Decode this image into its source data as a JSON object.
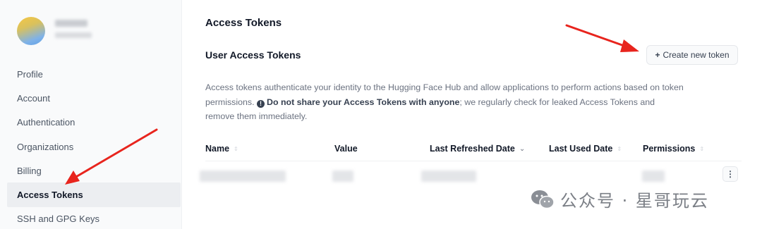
{
  "sidebar": {
    "items": [
      {
        "label": "Profile"
      },
      {
        "label": "Account"
      },
      {
        "label": "Authentication"
      },
      {
        "label": "Organizations"
      },
      {
        "label": "Billing"
      },
      {
        "label": "Access Tokens",
        "active": true
      },
      {
        "label": "SSH and GPG Keys"
      }
    ]
  },
  "main": {
    "page_title": "Access Tokens",
    "section_title": "User Access Tokens",
    "create_button_label": "Create new token",
    "description": {
      "part1": "Access tokens authenticate your identity to the Hugging Face Hub and allow applications to perform actions based on token permissions.",
      "warning": "Do not share your Access Tokens with anyone",
      "part2": "; we regularly check for leaked Access Tokens and remove them immediately."
    },
    "table": {
      "columns": [
        "Name",
        "Value",
        "Last Refreshed Date",
        "Last Used Date",
        "Permissions"
      ],
      "sorted_column": "Last Refreshed Date"
    }
  },
  "watermark": {
    "text": "公众号 · 星哥玩云"
  },
  "colors": {
    "annotation_arrow": "#e8241d",
    "active_nav_bg": "#eceef1"
  },
  "icons": {
    "create": "plus-icon",
    "warning": "info-icon",
    "sort": "sort-icon",
    "row_menu": "kebab-menu-icon"
  }
}
